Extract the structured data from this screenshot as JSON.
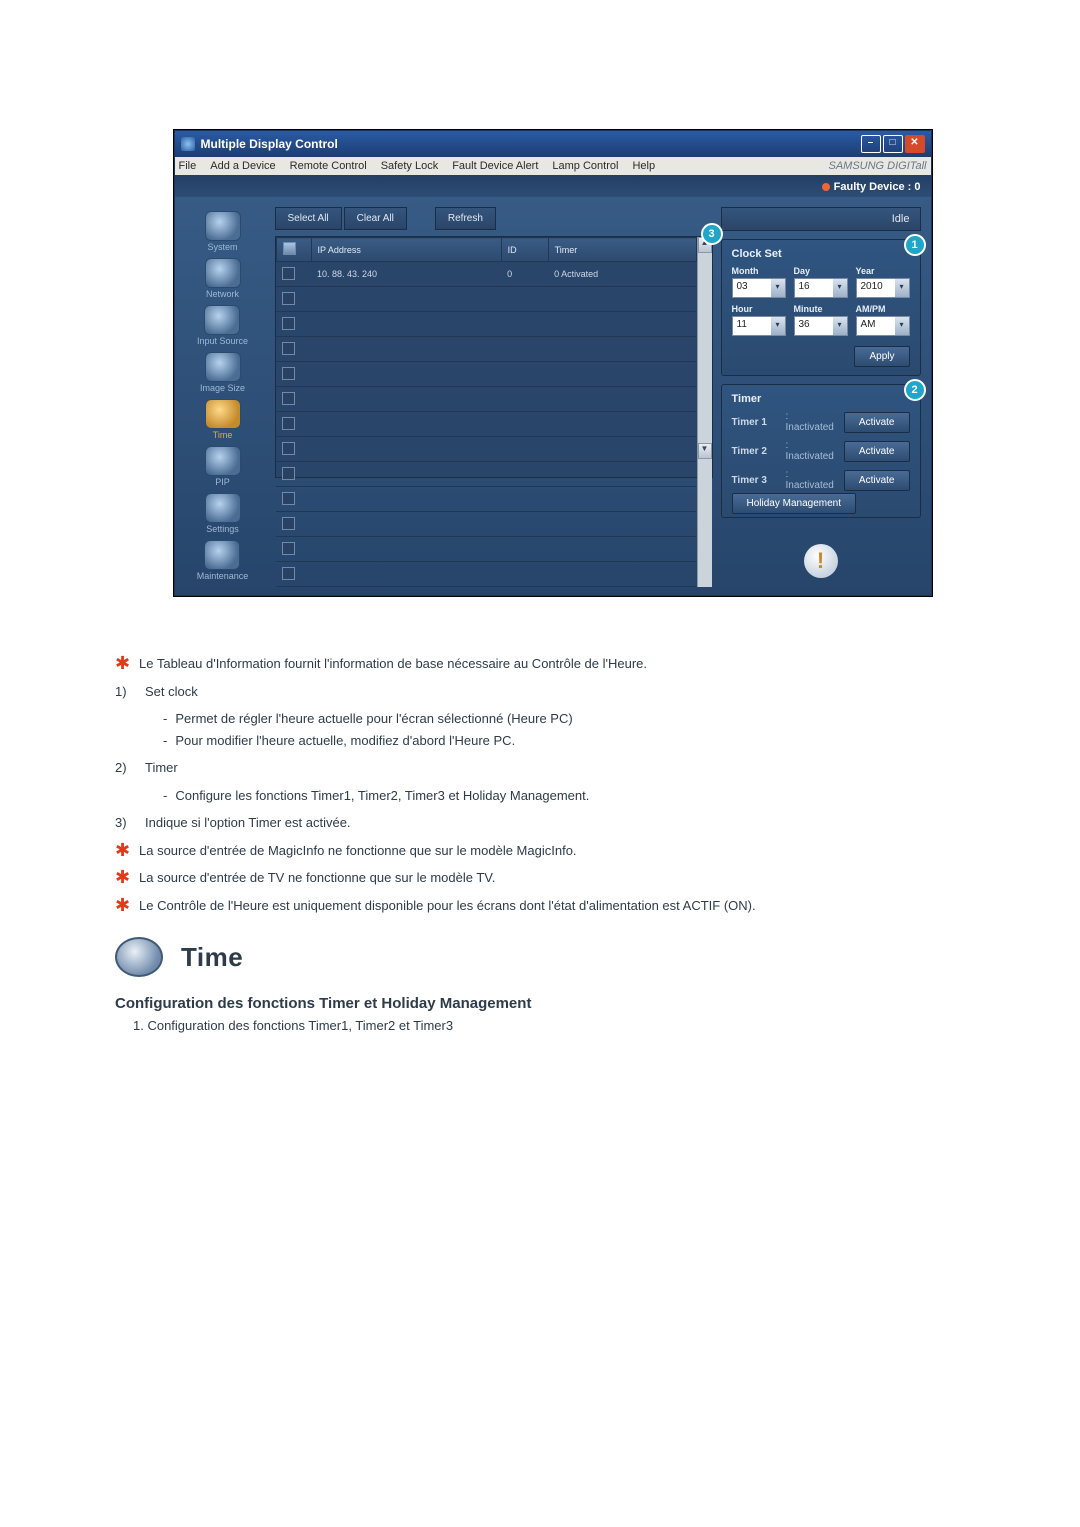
{
  "window": {
    "title": "Multiple Display Control",
    "menus": [
      "File",
      "Add a Device",
      "Remote Control",
      "Safety Lock",
      "Fault Device Alert",
      "Lamp Control",
      "Help"
    ],
    "brand": "SAMSUNG DIGITall",
    "faulty": "Faulty Device : 0",
    "idle": "Idle",
    "toolbar": {
      "select_all": "Select All",
      "clear_all": "Clear All",
      "refresh": "Refresh"
    }
  },
  "sidebar": {
    "items": [
      {
        "label": "System"
      },
      {
        "label": "Network"
      },
      {
        "label": "Input Source"
      },
      {
        "label": "Image Size"
      },
      {
        "label": "Time",
        "active": true
      },
      {
        "label": "PIP"
      },
      {
        "label": "Settings"
      },
      {
        "label": "Maintenance"
      }
    ]
  },
  "table": {
    "cols": [
      "",
      "IP Address",
      "ID",
      "Timer"
    ],
    "rows": [
      {
        "checked": true,
        "ip": "10. 88. 43. 240",
        "id": "0",
        "timer": "0 Activated"
      }
    ]
  },
  "clock": {
    "title": "Clock Set",
    "fields": {
      "month": {
        "label": "Month",
        "value": "03"
      },
      "day": {
        "label": "Day",
        "value": "16"
      },
      "year": {
        "label": "Year",
        "value": "2010"
      },
      "hour": {
        "label": "Hour",
        "value": "11"
      },
      "minute": {
        "label": "Minute",
        "value": "36"
      },
      "ampm": {
        "label": "AM/PM",
        "value": "AM"
      }
    },
    "apply": "Apply"
  },
  "timer": {
    "title": "Timer",
    "rows": [
      {
        "name": "Timer 1",
        "status": ": Inactivated",
        "btn": "Activate"
      },
      {
        "name": "Timer 2",
        "status": ": Inactivated",
        "btn": "Activate"
      },
      {
        "name": "Timer 3",
        "status": ": Inactivated",
        "btn": "Activate"
      }
    ],
    "holiday": "Holiday Management"
  },
  "doc": {
    "lines": [
      "Le Tableau d'Information fournit l'information de base nécessaire au Contrôle de l'Heure.",
      "Set clock",
      "Permet de régler l'heure actuelle pour l'écran sélectionné (Heure PC)",
      "Pour modifier l'heure actuelle, modifiez d'abord l'Heure PC.",
      "Timer",
      "Configure les fonctions Timer1, Timer2, Timer3 et Holiday Management.",
      "Indique si l'option Timer est activée.",
      "La source d'entrée de MagicInfo ne fonctionne que sur le modèle MagicInfo.",
      "La source d'entrée de TV ne fonctionne que sur le modèle TV.",
      "Le Contrôle de l'Heure est uniquement disponible pour les écrans dont l'état d'alimentation est ACTIF (ON)."
    ],
    "n1": "1)",
    "n2": "2)",
    "n3": "3)",
    "section_title": "Time",
    "subhead": "Configuration des fonctions Timer et Holiday Management",
    "step1": "1.  Configuration des fonctions Timer1, Timer2 et Timer3"
  }
}
